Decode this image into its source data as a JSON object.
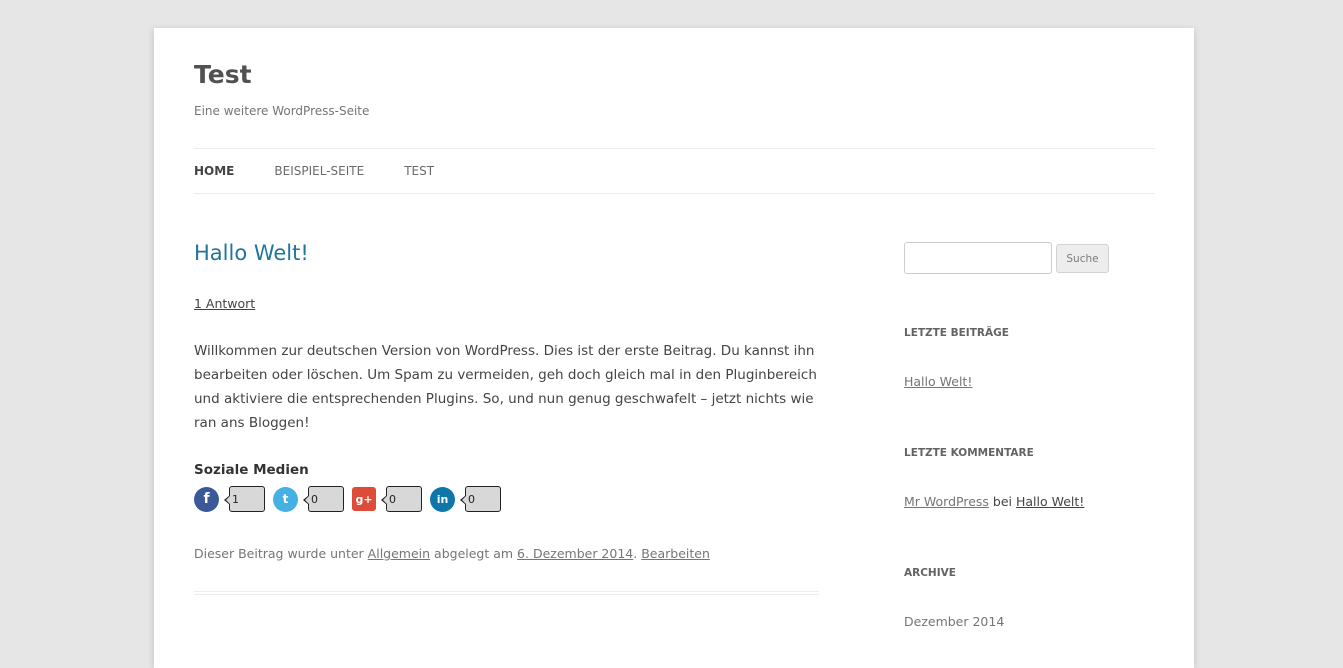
{
  "site": {
    "title": "Test",
    "description": "Eine weitere WordPress-Seite"
  },
  "nav": {
    "items": [
      {
        "label": "HOME",
        "current": true
      },
      {
        "label": "BEISPIEL-SEITE",
        "current": false
      },
      {
        "label": "TEST",
        "current": false
      }
    ]
  },
  "post": {
    "title": "Hallo Welt!",
    "comments_link": "1 Antwort",
    "content": "Willkommen zur deutschen Version von WordPress. Dies ist der erste Beitrag. Du kannst ihn bearbeiten oder löschen. Um Spam zu vermeiden, geh doch gleich mal in den Pluginbereich und aktiviere die entsprechenden Plugins. So, und nun genug geschwafelt – jetzt nichts wie ran ans Bloggen!",
    "social": {
      "title": "Soziale Medien",
      "networks": [
        {
          "icon": "facebook-icon",
          "glyph": "f",
          "count": "1"
        },
        {
          "icon": "twitter-icon",
          "glyph": "t",
          "count": "0"
        },
        {
          "icon": "google-plus-icon",
          "glyph": "g+",
          "count": "0"
        },
        {
          "icon": "linkedin-icon",
          "glyph": "in",
          "count": "0"
        }
      ]
    },
    "meta": {
      "prefix": "Dieser Beitrag wurde unter ",
      "category": "Allgemein",
      "middle": " abgelegt am ",
      "date": "6. Dezember 2014",
      "separator": ". ",
      "edit": "Bearbeiten"
    }
  },
  "sidebar": {
    "search": {
      "value": "",
      "placeholder": "",
      "button_label": "Suche"
    },
    "recent_posts": {
      "title": "LETZTE BEITRÄGE",
      "items": [
        "Hallo Welt!"
      ]
    },
    "recent_comments": {
      "title": "LETZTE KOMMENTARE",
      "author": "Mr WordPress",
      "connector": " bei ",
      "post": "Hallo Welt!"
    },
    "archive": {
      "title": "ARCHIVE",
      "items": [
        "Dezember 2014"
      ]
    }
  },
  "colors": {
    "background": "#e6e6e6",
    "link_blue": "#21759b",
    "facebook": "#3b5998",
    "twitter": "#45b0e3",
    "google_plus": "#dd4b39",
    "linkedin": "#0e76a8"
  }
}
